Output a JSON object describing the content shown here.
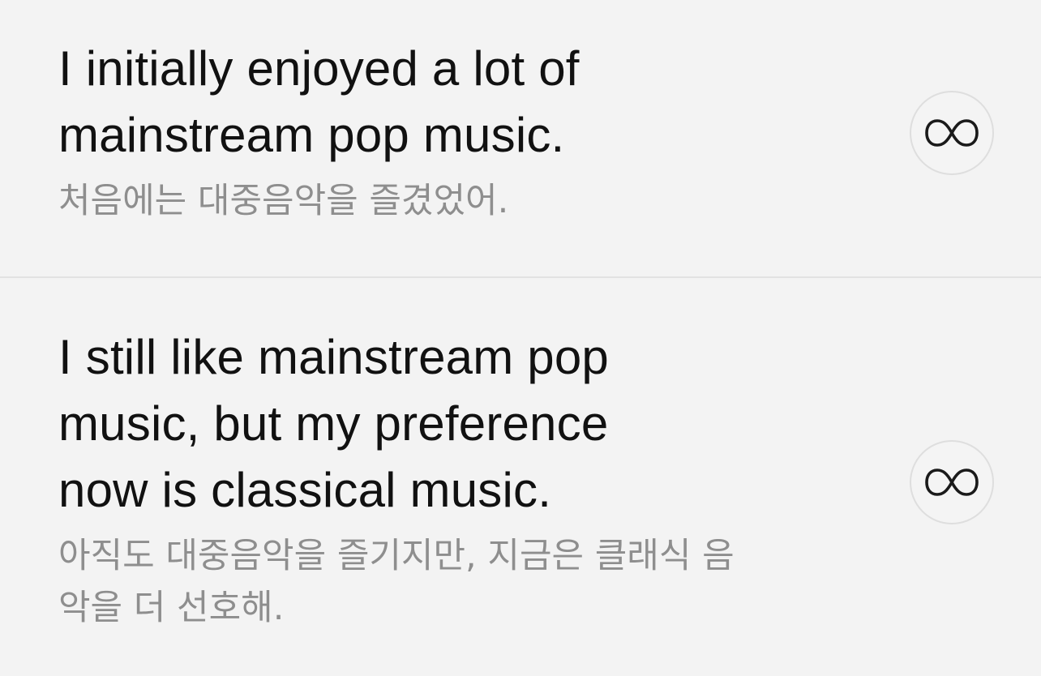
{
  "sentences": [
    {
      "english": "I initially enjoyed a lot of\nmainstream pop music.",
      "korean": "처음에는 대중음악을 즐겼었어.",
      "action_icon": "infinity-icon"
    },
    {
      "english": "I still like mainstream pop\nmusic, but my preference\nnow is classical music.",
      "korean": "아직도 대중음악을 즐기지만, 지금은 클래식 음\n악을 더 선호해.",
      "action_icon": "infinity-icon"
    }
  ],
  "colors": {
    "background": "#f3f3f3",
    "primary_text": "#111111",
    "secondary_text": "#8e8e8e",
    "divider": "#e2e2e2",
    "icon": "#1a1a1a"
  }
}
